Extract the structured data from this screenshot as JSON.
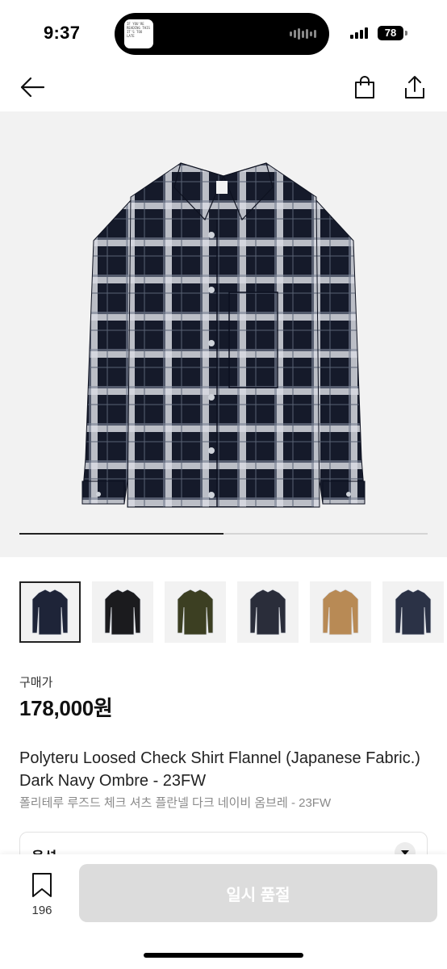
{
  "status_bar": {
    "time": "9:37",
    "battery": "78",
    "island_text": "IF YOU'RE READING THIS IT'S TOO LATE"
  },
  "nav": {
    "back_icon": "arrow-left-icon",
    "bag_icon": "shopping-bag-icon",
    "share_icon": "share-icon"
  },
  "gallery": {
    "progress": 0.5,
    "thumbnail_colors": [
      "#1e2438",
      "#1b1b1e",
      "#3c3f22",
      "#2a2d3a",
      "#b88a55",
      "#2b3246"
    ]
  },
  "product": {
    "price_label": "구매가",
    "price": "178,000원",
    "title": "Polyteru Loosed Check Shirt Flannel (Japanese Fabric.) Dark Navy Ombre - 23FW",
    "subtitle": "폴리테루 루즈드 체크 셔츠 플란넬 다크 네이비 옴브레 - 23FW"
  },
  "options": {
    "label": "옵션"
  },
  "bottom": {
    "wish_count": "196",
    "soldout_label": "일시 품절"
  },
  "colors": {
    "accent": "#222222",
    "disabled_button": "#dcdcdc"
  }
}
